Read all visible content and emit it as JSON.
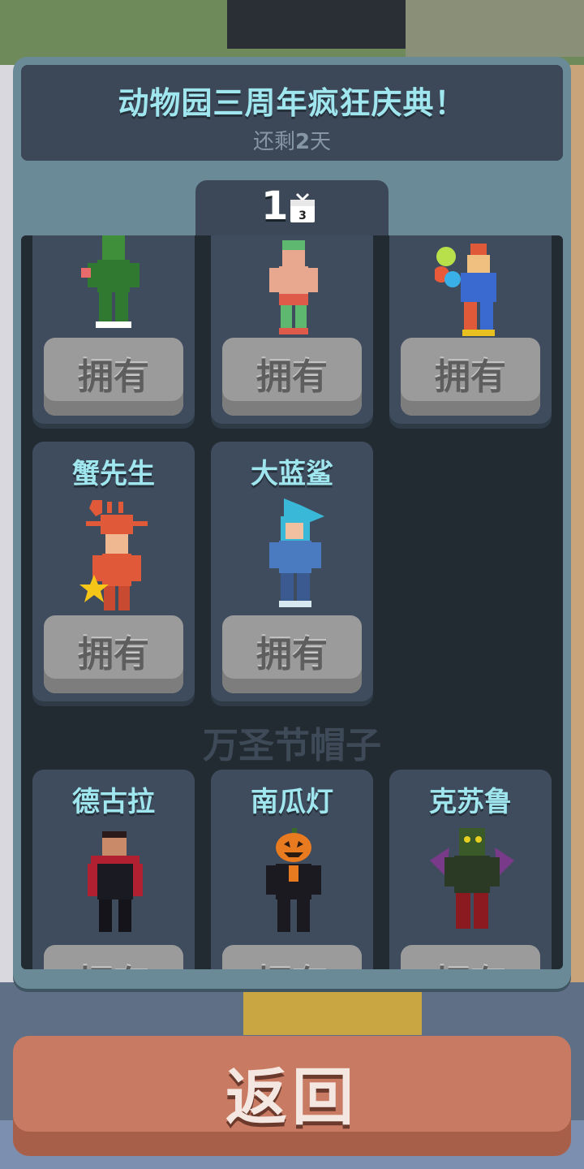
{
  "event": {
    "title": "动物园三周年疯狂庆典！",
    "countdown_prefix": "还剩",
    "countdown_value": "2",
    "countdown_suffix": "天"
  },
  "tab": {
    "number": "1",
    "gift_day": "3"
  },
  "own_label": "拥有",
  "row1": [
    {
      "name": ""
    },
    {
      "name": ""
    },
    {
      "name": ""
    }
  ],
  "row2": [
    {
      "name": "蟹先生"
    },
    {
      "name": "大蓝鲨"
    }
  ],
  "section": {
    "halloween_title": "万圣节帽子"
  },
  "row3": [
    {
      "name": "德古拉"
    },
    {
      "name": "南瓜灯"
    },
    {
      "name": "克苏鲁"
    }
  ],
  "footer": {
    "return_label": "返回"
  },
  "colors": {
    "title": "#9fe6ee",
    "panel": "#6a8a98",
    "card": "#3f4c5d",
    "return_button": "#c97a62"
  }
}
